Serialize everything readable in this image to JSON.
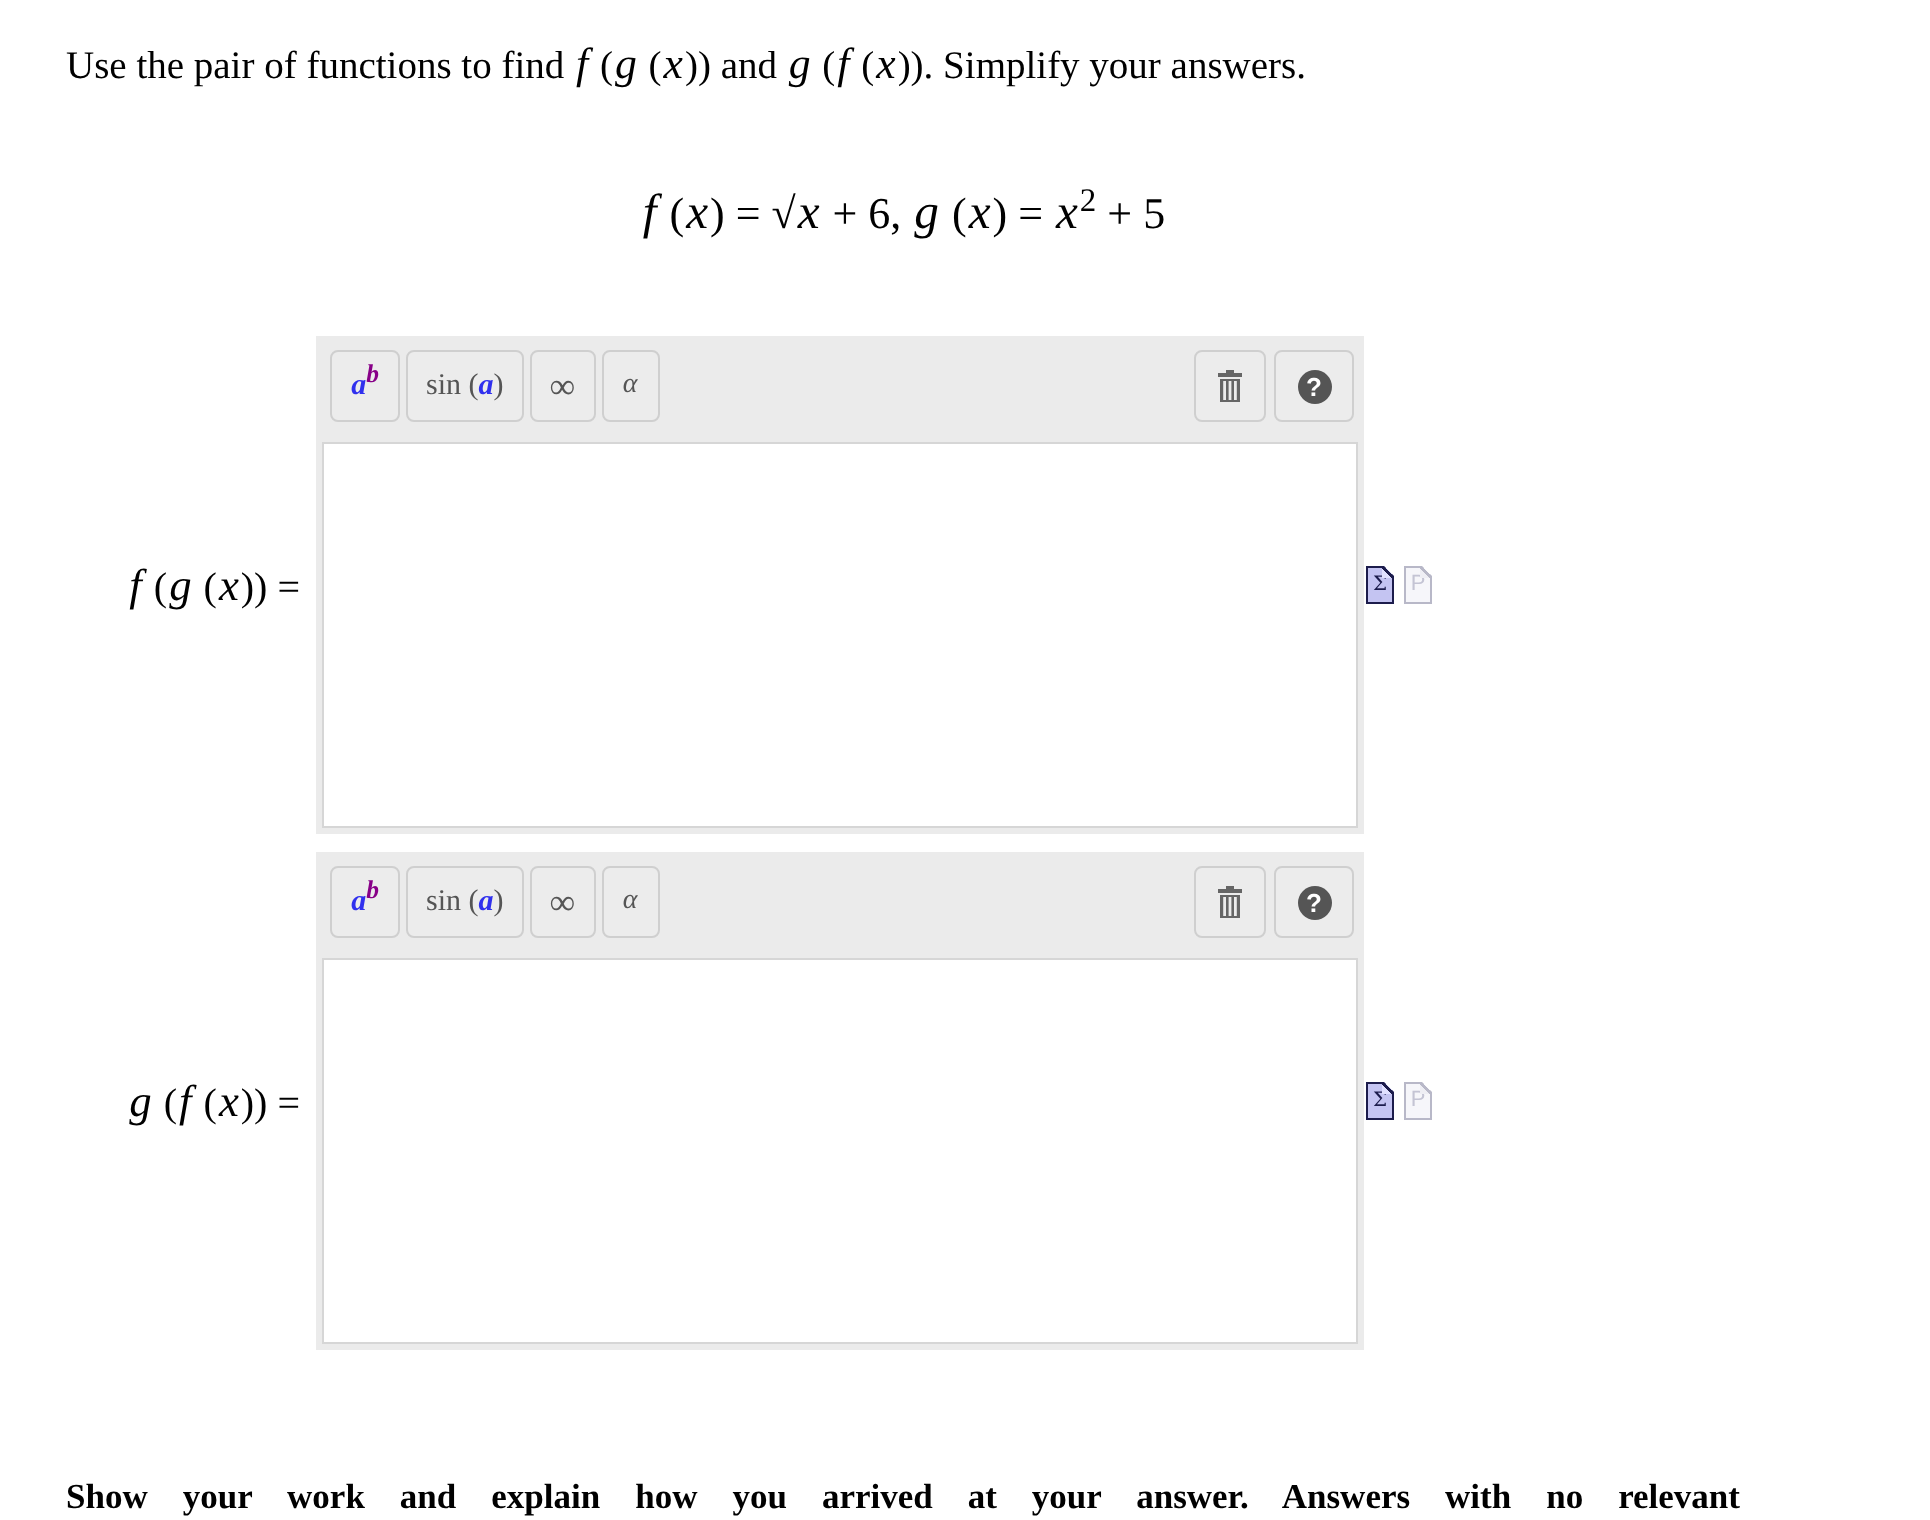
{
  "question": "Use the pair of functions to find *f* (*g* (*x*)) and *g* (*f* (*x*)). Simplify your answers.",
  "formula": "*f* (*x*) = √*x* + 6, *g* (*x*) = *x*$^{2}$ + 5",
  "answers": [
    {
      "label": "*f* (*g* (*x*)) =",
      "toolbar": [
        {
          "kind": "power",
          "label": "*a*$^{b}$"
        },
        {
          "kind": "function",
          "label": "sin (*a*)"
        },
        {
          "kind": "infinity",
          "label": "∞"
        },
        {
          "kind": "greek",
          "label": "α"
        }
      ],
      "help": "?",
      "modes": [
        {
          "kind": "equation",
          "symbol": "Σ",
          "selected": true
        },
        {
          "kind": "text",
          "symbol": "P",
          "selected": false
        }
      ]
    },
    {
      "label": "*g* (*f* (*x*)) =",
      "toolbar": [
        {
          "kind": "power",
          "label": "*a*$^{b}$"
        },
        {
          "kind": "function",
          "label": "sin (*a*)"
        },
        {
          "kind": "infinity",
          "label": "∞"
        },
        {
          "kind": "greek",
          "label": "α"
        }
      ],
      "help": "?",
      "modes": [
        {
          "kind": "equation",
          "symbol": "Σ",
          "selected": true
        },
        {
          "kind": "text",
          "symbol": "P",
          "selected": false
        }
      ]
    }
  ],
  "instructions": "Show your work and explain how you arrived at your answer. Answers with no relevant"
}
